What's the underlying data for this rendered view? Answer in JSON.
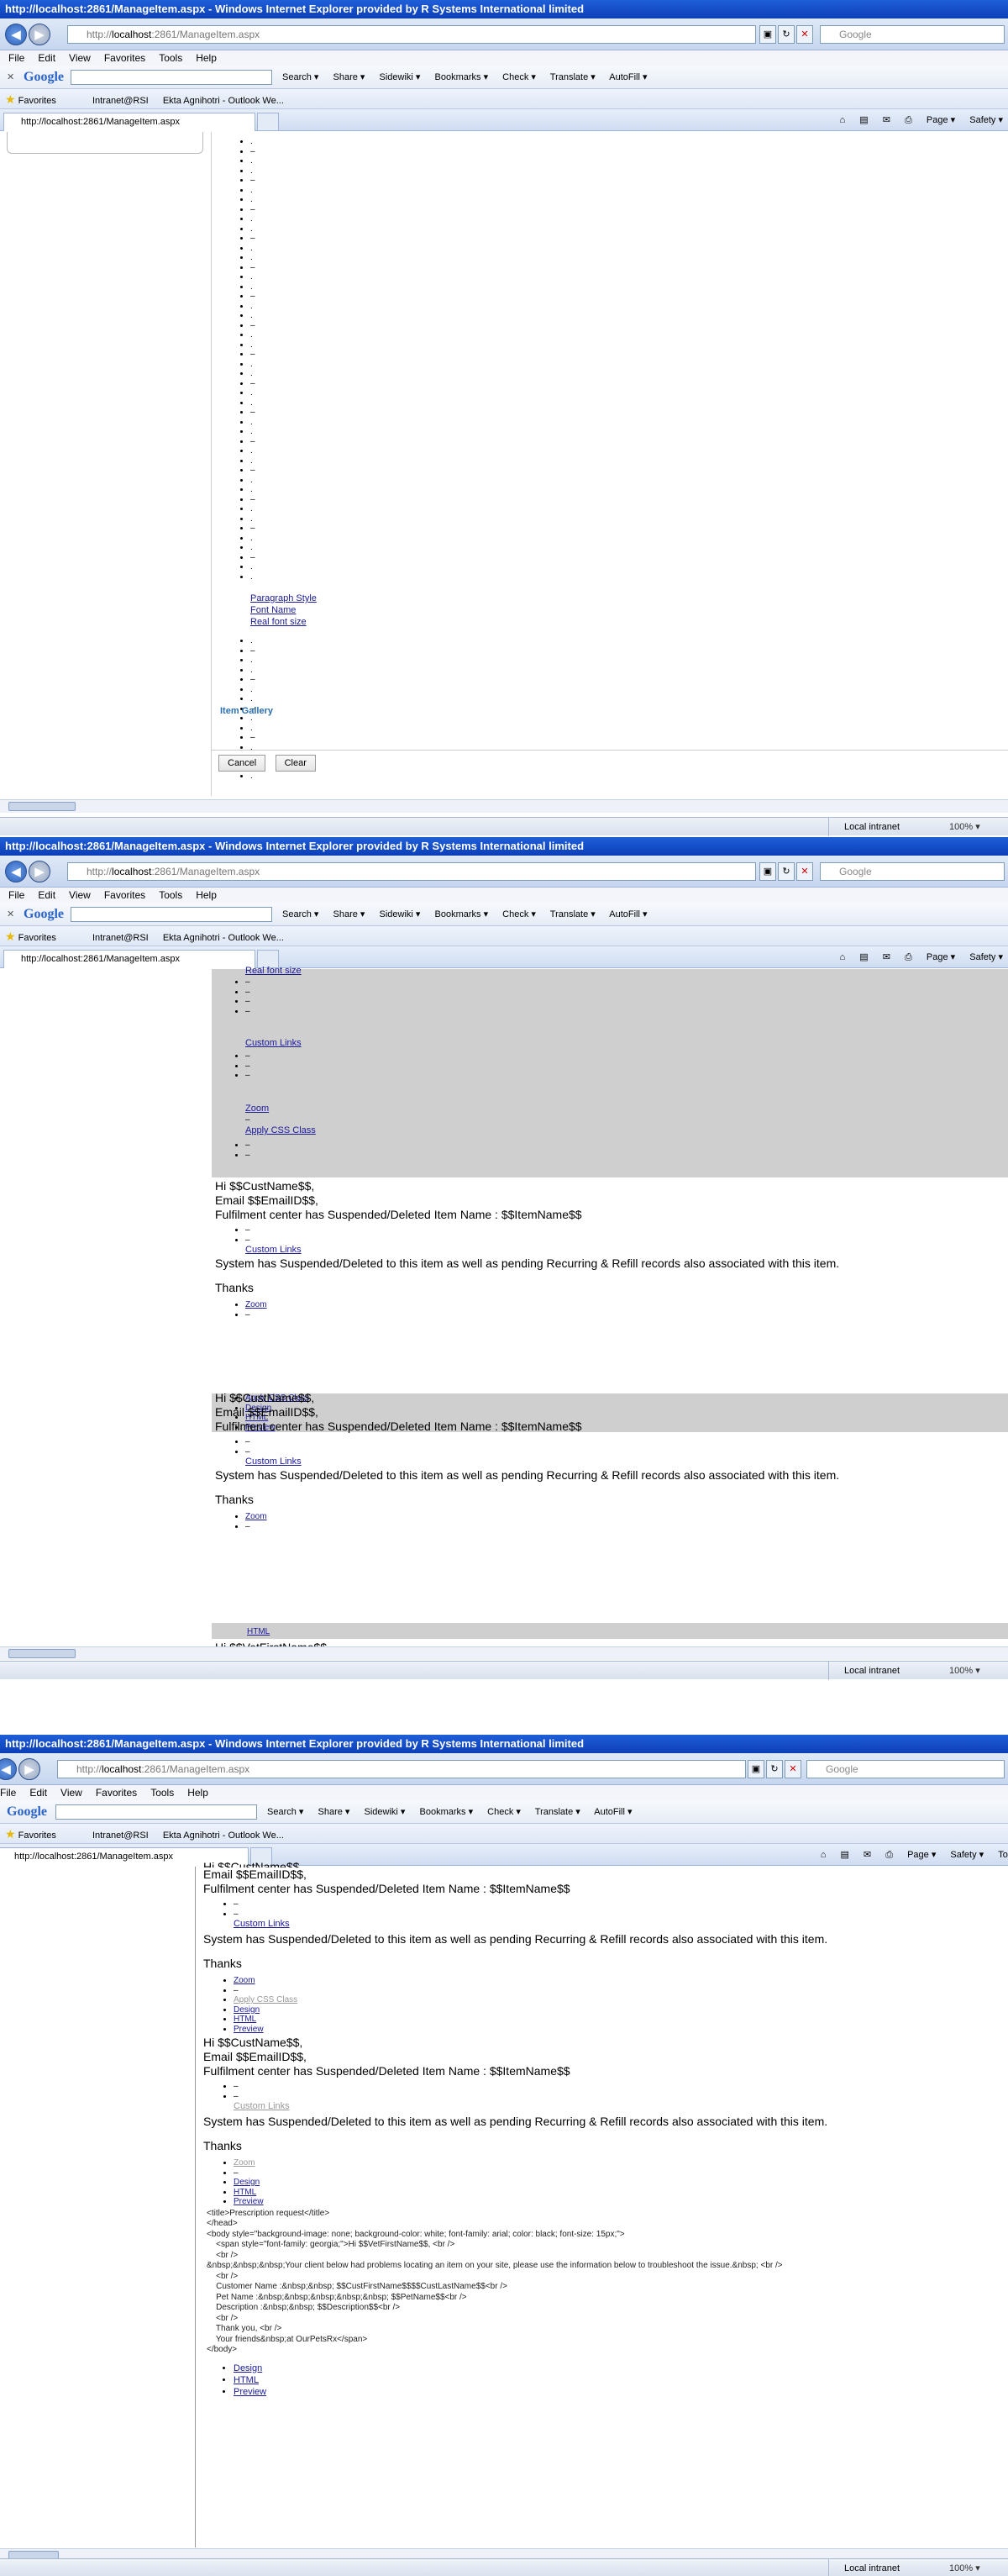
{
  "browser": {
    "title": "http://localhost:2861/ManageItem.aspx - Windows Internet Explorer provided by R Systems International limited",
    "address_prefix": "http://",
    "address_host": "localhost",
    "address_rest": ":2861/ManageItem.aspx",
    "search_placeholder": "Google",
    "menu": [
      "File",
      "Edit",
      "View",
      "Favorites",
      "Tools",
      "Help"
    ],
    "google_label": "Google",
    "google_items": [
      "Search ▾",
      "Share ▾",
      "Sidewiki ▾",
      "Bookmarks ▾",
      "Check ▾",
      "Translate ▾",
      "AutoFill ▾"
    ],
    "favorites_label": "Favorites",
    "favorites_items": [
      "Intranet@RSI",
      "Ekta Agnihotri - Outlook We..."
    ],
    "tab_label": "http://localhost:2861/ManageItem.aspx",
    "tab_tools": [
      "Page ▾",
      "Safety ▾"
    ],
    "tab_tools_short": [
      "Page ▾",
      "Safety ▾",
      "Too"
    ],
    "zone": "Local intranet",
    "zoom": "100% ▾"
  },
  "shot1": {
    "links": [
      "Paragraph Style",
      "Font Name",
      "Real font size"
    ],
    "item_gallery": "Item Gallery",
    "cancel": "Cancel",
    "clear": "Clear"
  },
  "shot2": {
    "top_partial": "Real font size",
    "custom_links": "Custom Links",
    "zoom": "Zoom",
    "apply_css": "Apply CSS Class",
    "design": "Design",
    "html": "HTML",
    "preview": "Preview",
    "hi_line": "Hi $$CustName$$,",
    "email_line": "Email $$EmailID$$,",
    "fulfil_line": "Fulfilment center has Suspended/Deleted Item Name : $$ItemName$$",
    "system_line": "System has Suspended/Deleted to this item as well as pending Recurring & Refill records also associated with this item.",
    "thanks": "Thanks",
    "vet_line": "Hi $$VetFirstName$$,"
  },
  "shot3": {
    "top_partial": "Hi $$CustName$$,",
    "code_lines": [
      "<title>Prescription request</title>",
      "</head>",
      "<body style=\"background-image: none; background-color: white; font-family: arial; color: black; font-size: 15px;\">",
      "    <span style=\"font-family: georgia;\">Hi $$VetFirstName$$, <br />",
      "    <br />",
      "&nbsp;&nbsp;&nbsp;Your client below had problems locating an item on your site, please use the information below to troubleshoot the issue.&nbsp; <br />",
      "    <br />",
      "    Customer Name :&nbsp;&nbsp; $$CustFirstName$$$$CustLastName$$<br />",
      "    Pet Name :&nbsp;&nbsp;&nbsp;&nbsp;&nbsp; $$PetName$$<br />",
      "    Description :&nbsp;&nbsp; $$Description$$<br />",
      "    <br />",
      "    Thank you, <br />",
      "    Your friends&nbsp;at OurPetsRx</span>",
      "</body>"
    ]
  }
}
